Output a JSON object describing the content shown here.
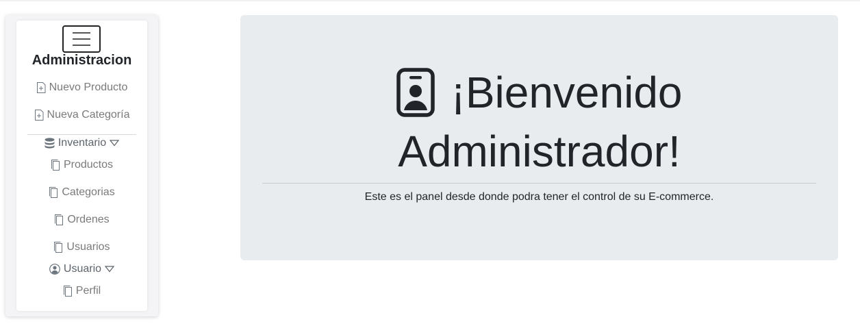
{
  "sidebar": {
    "brand": "Administracion",
    "links": [
      {
        "label": "Nuevo Producto",
        "icon": "file-plus-icon"
      },
      {
        "label": "Nueva Categoría",
        "icon": "file-plus-icon"
      }
    ],
    "inventario": {
      "label": "Inventario",
      "icon": "database-icon",
      "items": [
        {
          "label": "Productos",
          "icon": "files-icon"
        },
        {
          "label": "Categorias",
          "icon": "files-icon"
        },
        {
          "label": "Ordenes",
          "icon": "files-icon"
        },
        {
          "label": "Usuarios",
          "icon": "files-icon"
        }
      ]
    },
    "usuario": {
      "label": "Usuario",
      "icon": "person-circle-icon",
      "items": [
        {
          "label": "Perfil",
          "icon": "files-icon"
        }
      ]
    }
  },
  "main": {
    "welcome_line1": "¡Bienvenido",
    "welcome_line2": "Administrador!",
    "welcome_icon": "person-badge-icon",
    "lead": "Este es el panel desde donde podra tener el control de su E-commerce."
  },
  "colors": {
    "card_bg": "#e9ecef",
    "text": "#212529",
    "muted_link": "#7a7a7a"
  }
}
